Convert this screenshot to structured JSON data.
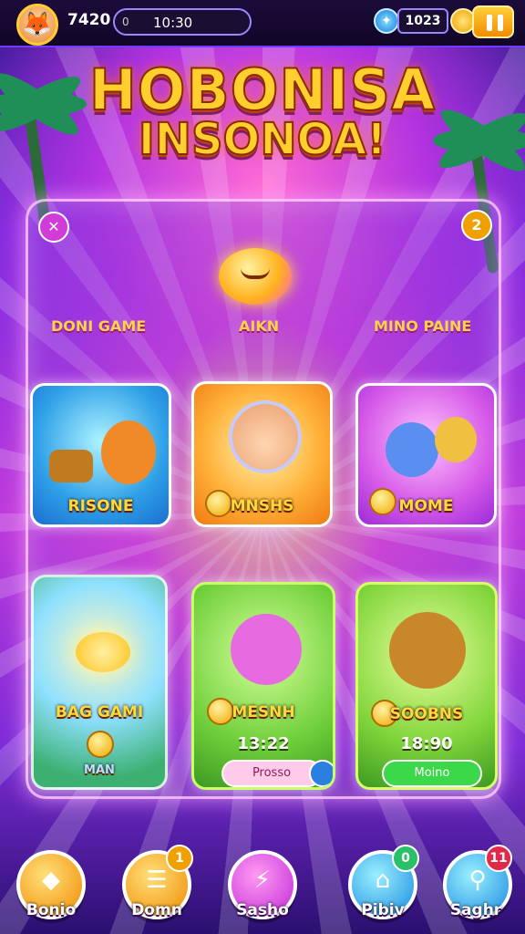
{
  "header": {
    "score": "7420",
    "time_small": "0",
    "time": "10:30",
    "gems": "1023"
  },
  "title": {
    "line1": "HOBONISA",
    "line2": "INSONOA!"
  },
  "board": {
    "headers": [
      "DONI GAME",
      "AIKN",
      "MINO PAINE"
    ],
    "badge_right": "2",
    "cards": [
      {
        "label": "RISONE"
      },
      {
        "label": "MNSHS"
      },
      {
        "label": "MOME"
      },
      {
        "label": "BAG GAMI",
        "sub": "MAN"
      },
      {
        "label": "MESNH",
        "time": "13:22",
        "button": "Prosso"
      },
      {
        "label": "SOOBNS",
        "time": "18:90",
        "button": "Moino"
      }
    ]
  },
  "nav": {
    "items": [
      {
        "label": "Bonio",
        "icon": "shield-icon"
      },
      {
        "label": "Domn",
        "icon": "scroll-icon",
        "badge": "1"
      },
      {
        "label": "Sasho",
        "icon": "plug-icon"
      },
      {
        "label": "Pibiv",
        "icon": "house-icon",
        "badge": "0"
      },
      {
        "label": "Saghr",
        "icon": "magnifier-icon",
        "badge": "11"
      }
    ]
  }
}
